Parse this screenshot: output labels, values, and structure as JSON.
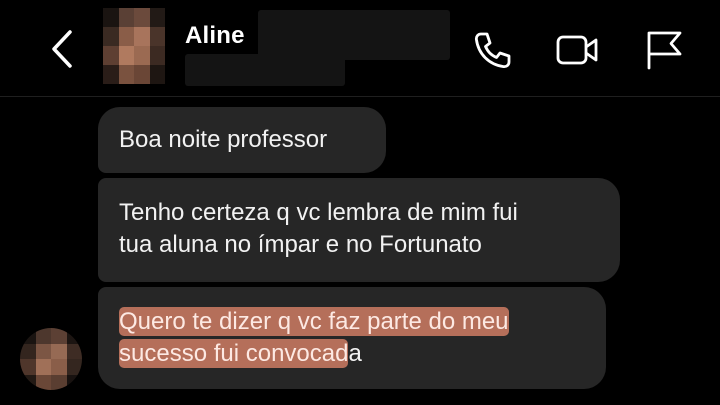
{
  "header": {
    "contact_name": "Aline",
    "icons": {
      "back": "chevron-left-icon",
      "call": "phone-icon",
      "video": "video-camera-icon",
      "report": "flag-icon"
    }
  },
  "messages": [
    {
      "lines": [
        "Boa noite professor"
      ]
    },
    {
      "lines": [
        "Tenho certeza q vc lembra de mim fui",
        "tua aluna no ímpar e no Fortunato"
      ]
    },
    {
      "highlighted_line_1": "Quero te dizer q vc faz parte do meu",
      "highlighted_line_2": "sucesso fui convocad",
      "trailing_text": "a"
    }
  ],
  "colors": {
    "background": "#000000",
    "bubble": "#262626",
    "highlight": "#d68067",
    "text": "#f2f2f2"
  }
}
